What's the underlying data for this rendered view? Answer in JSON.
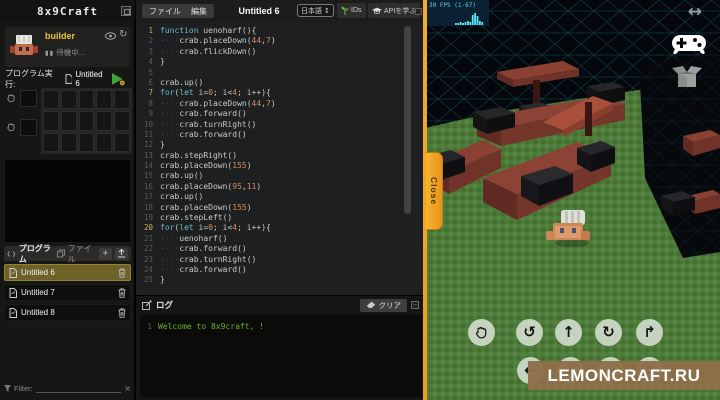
{
  "app": {
    "logo_text": "8x9Craft"
  },
  "menubar": {
    "file": "ファイル",
    "edit": "編集",
    "title": "Untitled 6",
    "language": "日本語",
    "language_arrow": "↕",
    "ids": "IDs",
    "learn_api": "APIを学ぶ"
  },
  "sidebar": {
    "character_name": "builder",
    "status_icon": "▮▮",
    "status_text": "待機中...",
    "refresh_icon": "↻",
    "run_label": "プログラム実行:",
    "run_target": "Untitled 6",
    "program_tab": "プログラム",
    "file_tab": "ファイル",
    "add_button": "+",
    "files": [
      {
        "name": "Untitled 6",
        "selected": true
      },
      {
        "name": "Untitled 7",
        "selected": false
      },
      {
        "name": "Untitled 8",
        "selected": false
      }
    ],
    "filter_label": "Filter:",
    "filter_clear": "×"
  },
  "editor": {
    "code_lines": [
      "function uenoharf(){",
      "    crab.placeDown(44,7)",
      "    crab.flickDown()",
      "}",
      "",
      "crab.up()",
      "for(let i=0; i<4; i++){",
      "    crab.placeDown(44,7)",
      "    crab.forward()",
      "    crab.turnRight()",
      "    crab.forward()",
      "}",
      "crab.stepRight()",
      "crab.placeDown(155)",
      "crab.up()",
      "crab.placeDown(95,11)",
      "crab.up()",
      "crab.placeDown(155)",
      "crab.stepLeft()",
      "for(let i=0; i<4; i++){",
      "    uenoharf()",
      "    crab.forward()",
      "    crab.turnRight()",
      "    crab.forward()",
      "}"
    ],
    "accent_gutter_lines": [
      1,
      7,
      20
    ]
  },
  "log": {
    "title": "ログ",
    "clear": "クリア",
    "collapse_icon": "–",
    "entries": [
      {
        "line": 1,
        "text": "Welcome to 8x9craft, !"
      }
    ]
  },
  "game": {
    "fps_label": "30 FPS (1-67)",
    "fps_bars": [
      2,
      2,
      3,
      2,
      3,
      4,
      3,
      10,
      12,
      9,
      4,
      3
    ],
    "resize_icon": "↔",
    "close_label": "Close",
    "watermark": "LEMONCRAFT.RU",
    "controls": {
      "rotate_ccw": "↺",
      "up": "↑",
      "rotate_cw": "↻",
      "turn_up": "↱",
      "left": "←",
      "down": "↓",
      "right": "→",
      "turn_down": "↴"
    },
    "colors": {
      "accent_orange": "#f2a21f",
      "grass_green": "#4d7a38",
      "wireframe_cyan": "#0f3f4a",
      "watermark_bg": "#8d6e49"
    }
  }
}
